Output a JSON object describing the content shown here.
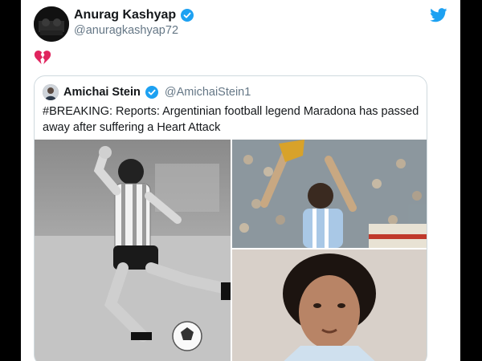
{
  "tweet": {
    "display_name": "Anurag Kashyap",
    "handle": "@anuragkashyap72",
    "emoji": "broken-heart-emoji"
  },
  "quoted": {
    "display_name": "Amichai Stein",
    "handle": "@AmichaiStein1",
    "text": "#BREAKING: Reports: Argentinian football legend Maradona has passed away after suffering a Heart Attack"
  },
  "colors": {
    "verified": "#1da1f2",
    "twitter_blue": "#1da1f2",
    "broken_heart": "#e0245e"
  },
  "icons": {
    "verified": "verified-badge-icon",
    "logo": "twitter-bird-icon"
  }
}
